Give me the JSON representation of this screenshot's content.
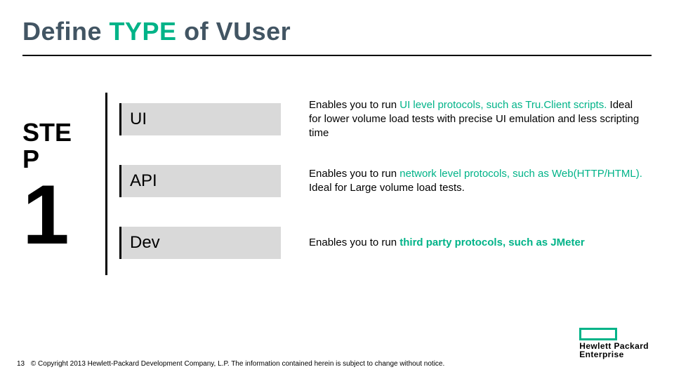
{
  "title": {
    "w1": "Define",
    "w2": "TYPE",
    "w3": "of",
    "w4": "VUser"
  },
  "step": {
    "label": "STE\nP",
    "label_line1": "STE",
    "label_line2": "P",
    "num": "1"
  },
  "rows": [
    {
      "badge": "UI",
      "pre": "Enables you to run ",
      "accent": " UI level protocols, such as Tru.Client scripts.",
      "post": " Ideal for lower volume load tests with precise UI emulation and less scripting time"
    },
    {
      "badge": "API",
      "pre": "Enables you to run ",
      "accent": "network level protocols, such as Web(HTTP/HTML).",
      "post": " Ideal for Large volume load tests."
    },
    {
      "badge": "Dev",
      "pre": "Enables you to run ",
      "accent": "third party protocols, such as JMeter",
      "post": ""
    }
  ],
  "footer": {
    "page": "13",
    "copyright": "© Copyright 2013 Hewlett-Packard Development Company, L.P.  The information contained herein is subject to change without notice."
  },
  "logo": {
    "line1": "Hewlett Packard",
    "line2": "Enterprise"
  }
}
